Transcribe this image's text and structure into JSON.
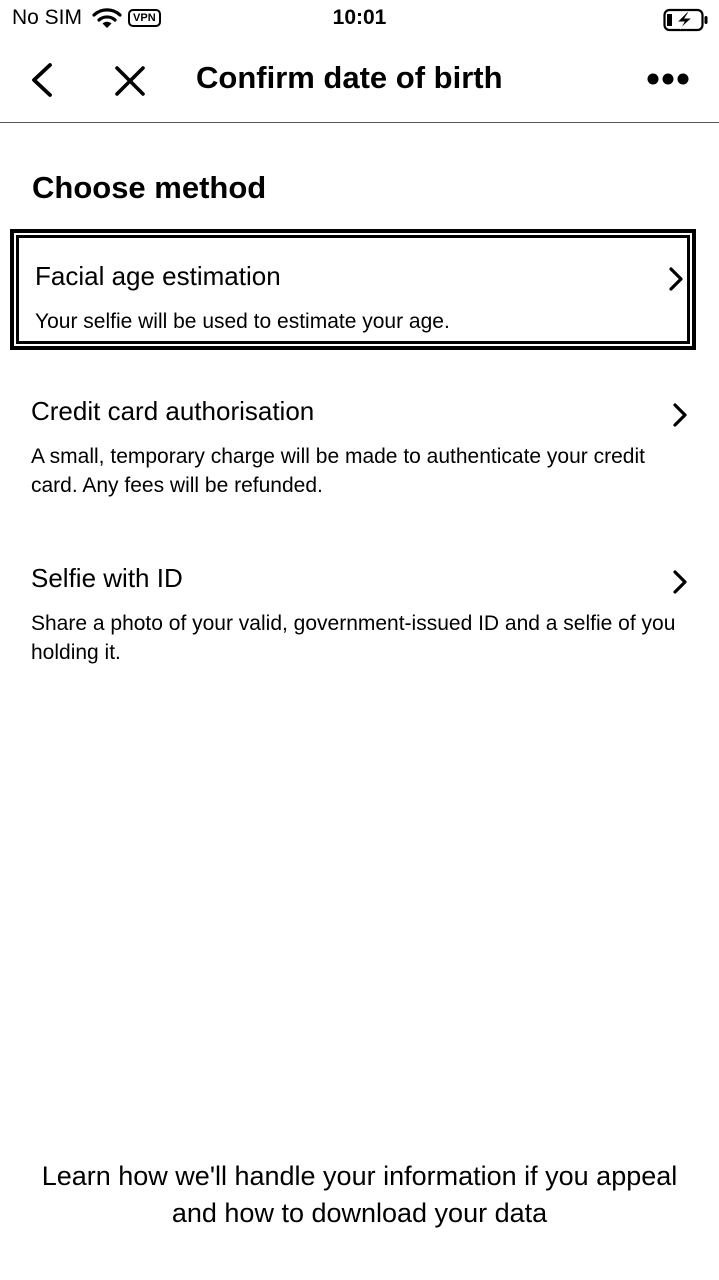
{
  "status_bar": {
    "carrier": "No SIM",
    "vpn": "VPN",
    "time": "10:01",
    "icons": [
      "wifi-icon",
      "battery-charging-icon"
    ]
  },
  "nav": {
    "title": "Confirm date of birth",
    "icons": [
      "back-icon",
      "close-icon",
      "more-icon"
    ]
  },
  "main": {
    "heading": "Choose method",
    "methods": [
      {
        "title": "Facial age estimation",
        "description": "Your selfie will be used to estimate your age.",
        "selected": true
      },
      {
        "title": "Credit card authorisation",
        "description": "A small, temporary charge will be made to authenticate your credit card. Any fees will be refunded.",
        "selected": false
      },
      {
        "title": "Selfie with ID",
        "description": "Share a photo of your valid, government-issued ID and a selfie of you holding it.",
        "selected": false
      }
    ]
  },
  "footer": {
    "link_text": "Learn how we'll handle your information if you appeal and how to download your data"
  }
}
